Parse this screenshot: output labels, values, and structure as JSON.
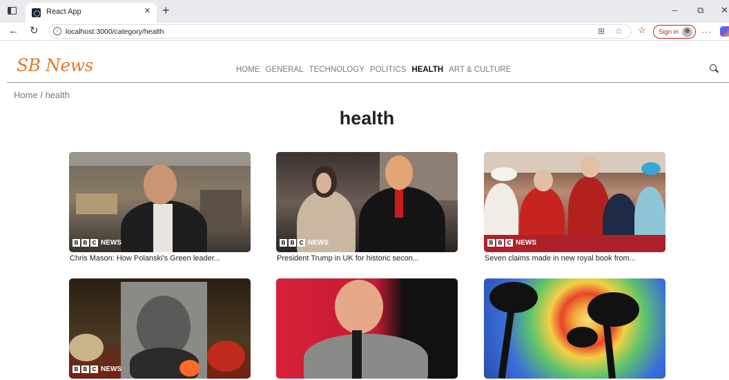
{
  "browser": {
    "tab_title": "React App",
    "url": "localhost:3000/category/health",
    "sign_in_label": "Sign in"
  },
  "site": {
    "logo": "SB News",
    "nav": [
      {
        "label": "HOME",
        "active": false
      },
      {
        "label": "GENERAL",
        "active": false
      },
      {
        "label": "TECHNOLOGY",
        "active": false
      },
      {
        "label": "POLITICS",
        "active": false
      },
      {
        "label": "HEALTH",
        "active": true
      },
      {
        "label": "ART & CULTURE",
        "active": false
      }
    ]
  },
  "breadcrumb": {
    "home": "Home",
    "separator": "/",
    "current": "health"
  },
  "page_title": "health",
  "badge": {
    "letters": [
      "B",
      "B",
      "C"
    ],
    "label": "NEWS"
  },
  "cards": [
    {
      "caption": "Chris Mason: How Polanski's Green leader...",
      "has_badge": true
    },
    {
      "caption": "President Trump in UK for historic secon...",
      "has_badge": true
    },
    {
      "caption": "Seven claims made in new royal book from...",
      "has_badge": true
    },
    {
      "caption": "",
      "has_badge": true
    },
    {
      "caption": "",
      "has_badge": false
    },
    {
      "caption": "",
      "has_badge": false
    }
  ],
  "colors": {
    "logo": "#e07a2a",
    "active_nav": "#111111",
    "nav": "#7a7a7a"
  }
}
